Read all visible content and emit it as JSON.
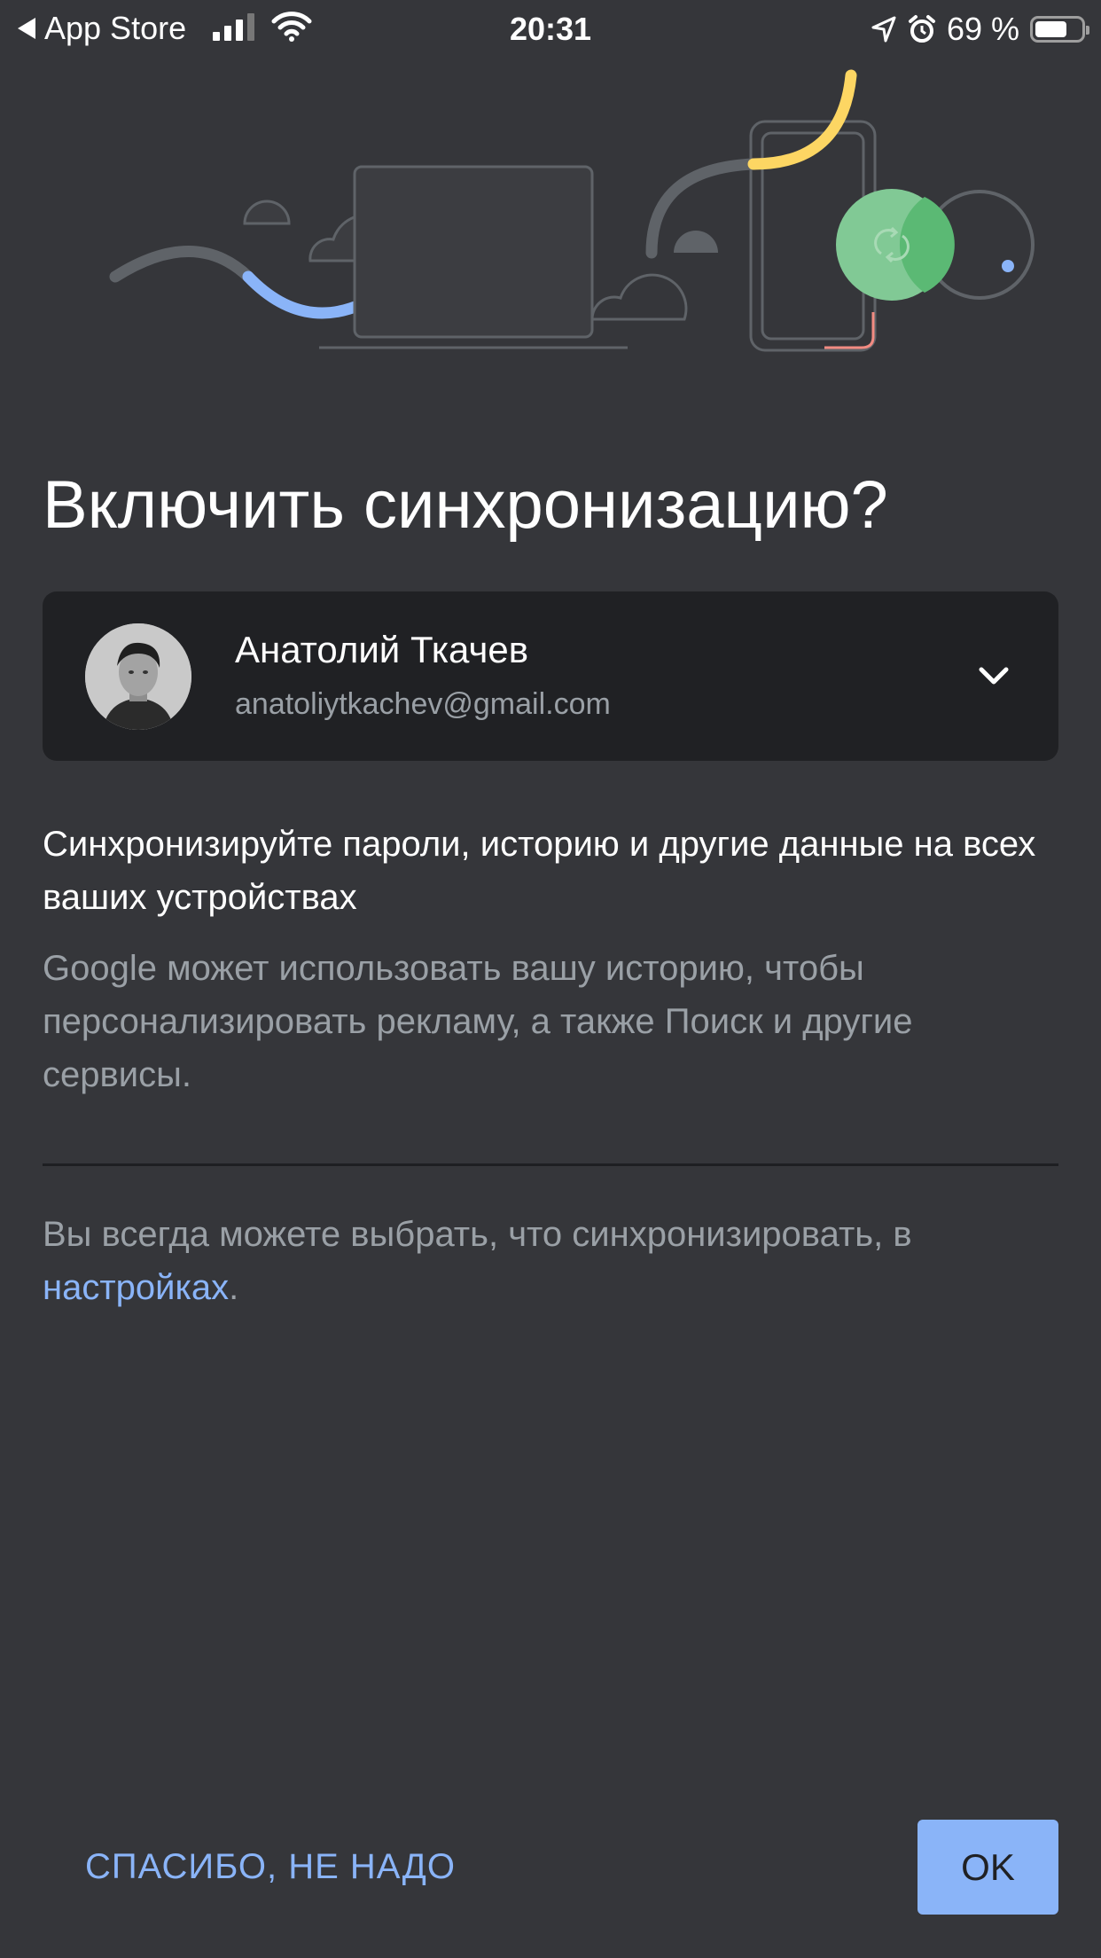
{
  "status_bar": {
    "back_label": "App Store",
    "time": "20:31",
    "battery_percent": "69 %",
    "battery_level": 0.69
  },
  "dialog": {
    "title": "Включить синхронизацию?",
    "account": {
      "name": "Анатолий Ткачев",
      "email": "anatoliytkachev@gmail.com"
    },
    "description_primary": "Синхронизируйте пароли, историю и другие данные на всех ваших устройствах",
    "description_secondary": "Google может использовать вашу историю, чтобы персонализировать рекламу, а также Поиск и другие сервисы.",
    "settings_note_prefix": "Вы всегда можете выбрать, что синхронизировать, в ",
    "settings_link": "настройках",
    "settings_note_suffix": ".",
    "decline_label": "СПАСИБО, НЕ НАДО",
    "ok_label": "OK"
  },
  "colors": {
    "background": "#35363a",
    "card": "#202124",
    "accent": "#8ab4f8",
    "secondary_text": "#9aa0a6",
    "sync_green": "#81c995",
    "yellow": "#fdd663",
    "blue": "#8ab4f8",
    "red": "#f28b82"
  },
  "icons": {
    "back": "back-arrow-icon",
    "signal": "cellular-signal-icon",
    "wifi": "wifi-icon",
    "location": "location-arrow-icon",
    "alarm": "alarm-clock-icon",
    "battery": "battery-icon",
    "sync": "sync-icon",
    "expand": "chevron-down-icon"
  }
}
